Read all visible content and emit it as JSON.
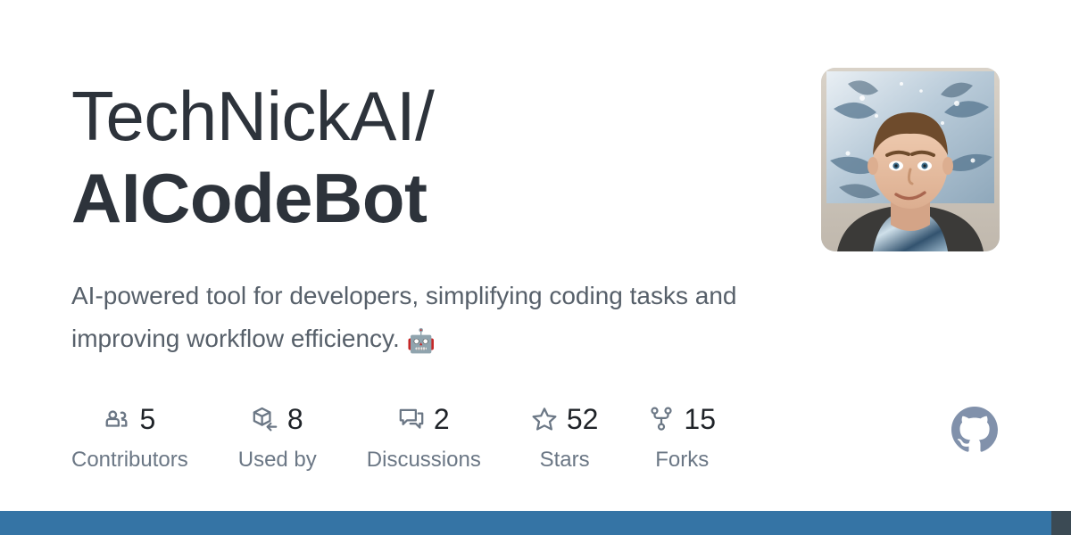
{
  "repo": {
    "owner": "TechNickAI/",
    "name": "AICodeBot",
    "description": "AI-powered tool for developers, simplifying coding tasks and improving workflow efficiency. ",
    "description_emoji": "🤖"
  },
  "avatar": {
    "alt": "owner-avatar",
    "description": "Photo of a person in front of blue and white abstract artwork"
  },
  "stats": [
    {
      "icon": "people-icon",
      "value": "5",
      "label": "Contributors"
    },
    {
      "icon": "package-dependents-icon",
      "value": "8",
      "label": "Used by"
    },
    {
      "icon": "comment-discussion-icon",
      "value": "2",
      "label": "Discussions"
    },
    {
      "icon": "star-icon",
      "value": "52",
      "label": "Stars"
    },
    {
      "icon": "repo-forked-icon",
      "value": "15",
      "label": "Forks"
    }
  ],
  "brand": {
    "icon": "github-mark-icon",
    "name": "GitHub"
  },
  "colors": {
    "title": "#2d333b",
    "description": "#57606a",
    "stat_value": "#1f2328",
    "stat_label": "#6b7785",
    "icon": "#6b7785",
    "brand_mark": "#8191ab",
    "bottom_bar": "#3574a5",
    "bottom_bar_alt": "#3b4a54",
    "background": "#ffffff"
  }
}
